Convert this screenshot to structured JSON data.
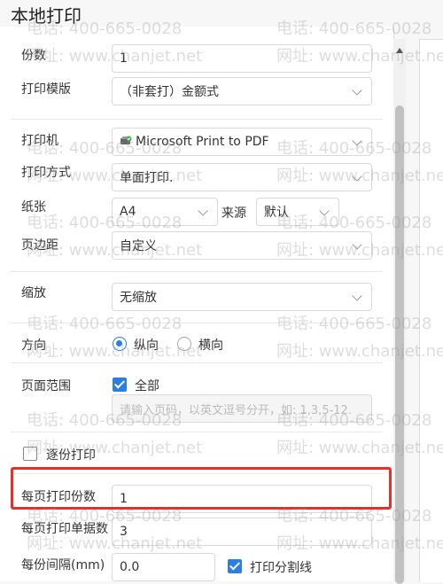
{
  "window": {
    "title": "本地打印"
  },
  "form": {
    "copies": {
      "label": "份数",
      "value": "1"
    },
    "template": {
      "label": "打印模版",
      "value": "（非套打）金额式"
    },
    "printer": {
      "label": "打印机",
      "value": "Microsoft Print to PDF"
    },
    "print_mode": {
      "label": "打印方式",
      "value": "单面打印."
    },
    "paper": {
      "label": "纸张",
      "value": "A4",
      "source_label": "来源",
      "source_value": "默认"
    },
    "margin": {
      "label": "页边距",
      "value": "自定义"
    },
    "scale": {
      "label": "缩放",
      "value": "无缩放"
    },
    "orientation": {
      "label": "方向",
      "options": [
        "纵向",
        "横向"
      ],
      "selected": "纵向"
    },
    "page_range": {
      "label": "页面范围",
      "all_label": "全部",
      "all_checked": true,
      "placeholder": "请输入页码，以英文逗号分开，如: 1,3,5-12."
    },
    "collate": {
      "label": "逐份打印",
      "checked": false
    },
    "copies_per_page": {
      "label": "每页打印份数",
      "value": "1"
    },
    "docs_per_page": {
      "label": "每页打印单据数",
      "value": "3"
    },
    "copy_gap": {
      "label": "每份间隔(mm)",
      "value": "0.0"
    },
    "divider": {
      "label": "打印分割线",
      "checked": true
    }
  },
  "watermark": {
    "phone": "电话: 400-665-0028",
    "site": "网址: www.chanjet.net"
  },
  "colors": {
    "accent": "#2b7ee4",
    "highlight": "#e5302b"
  },
  "icons": {
    "printer": "printer-status-icon"
  }
}
